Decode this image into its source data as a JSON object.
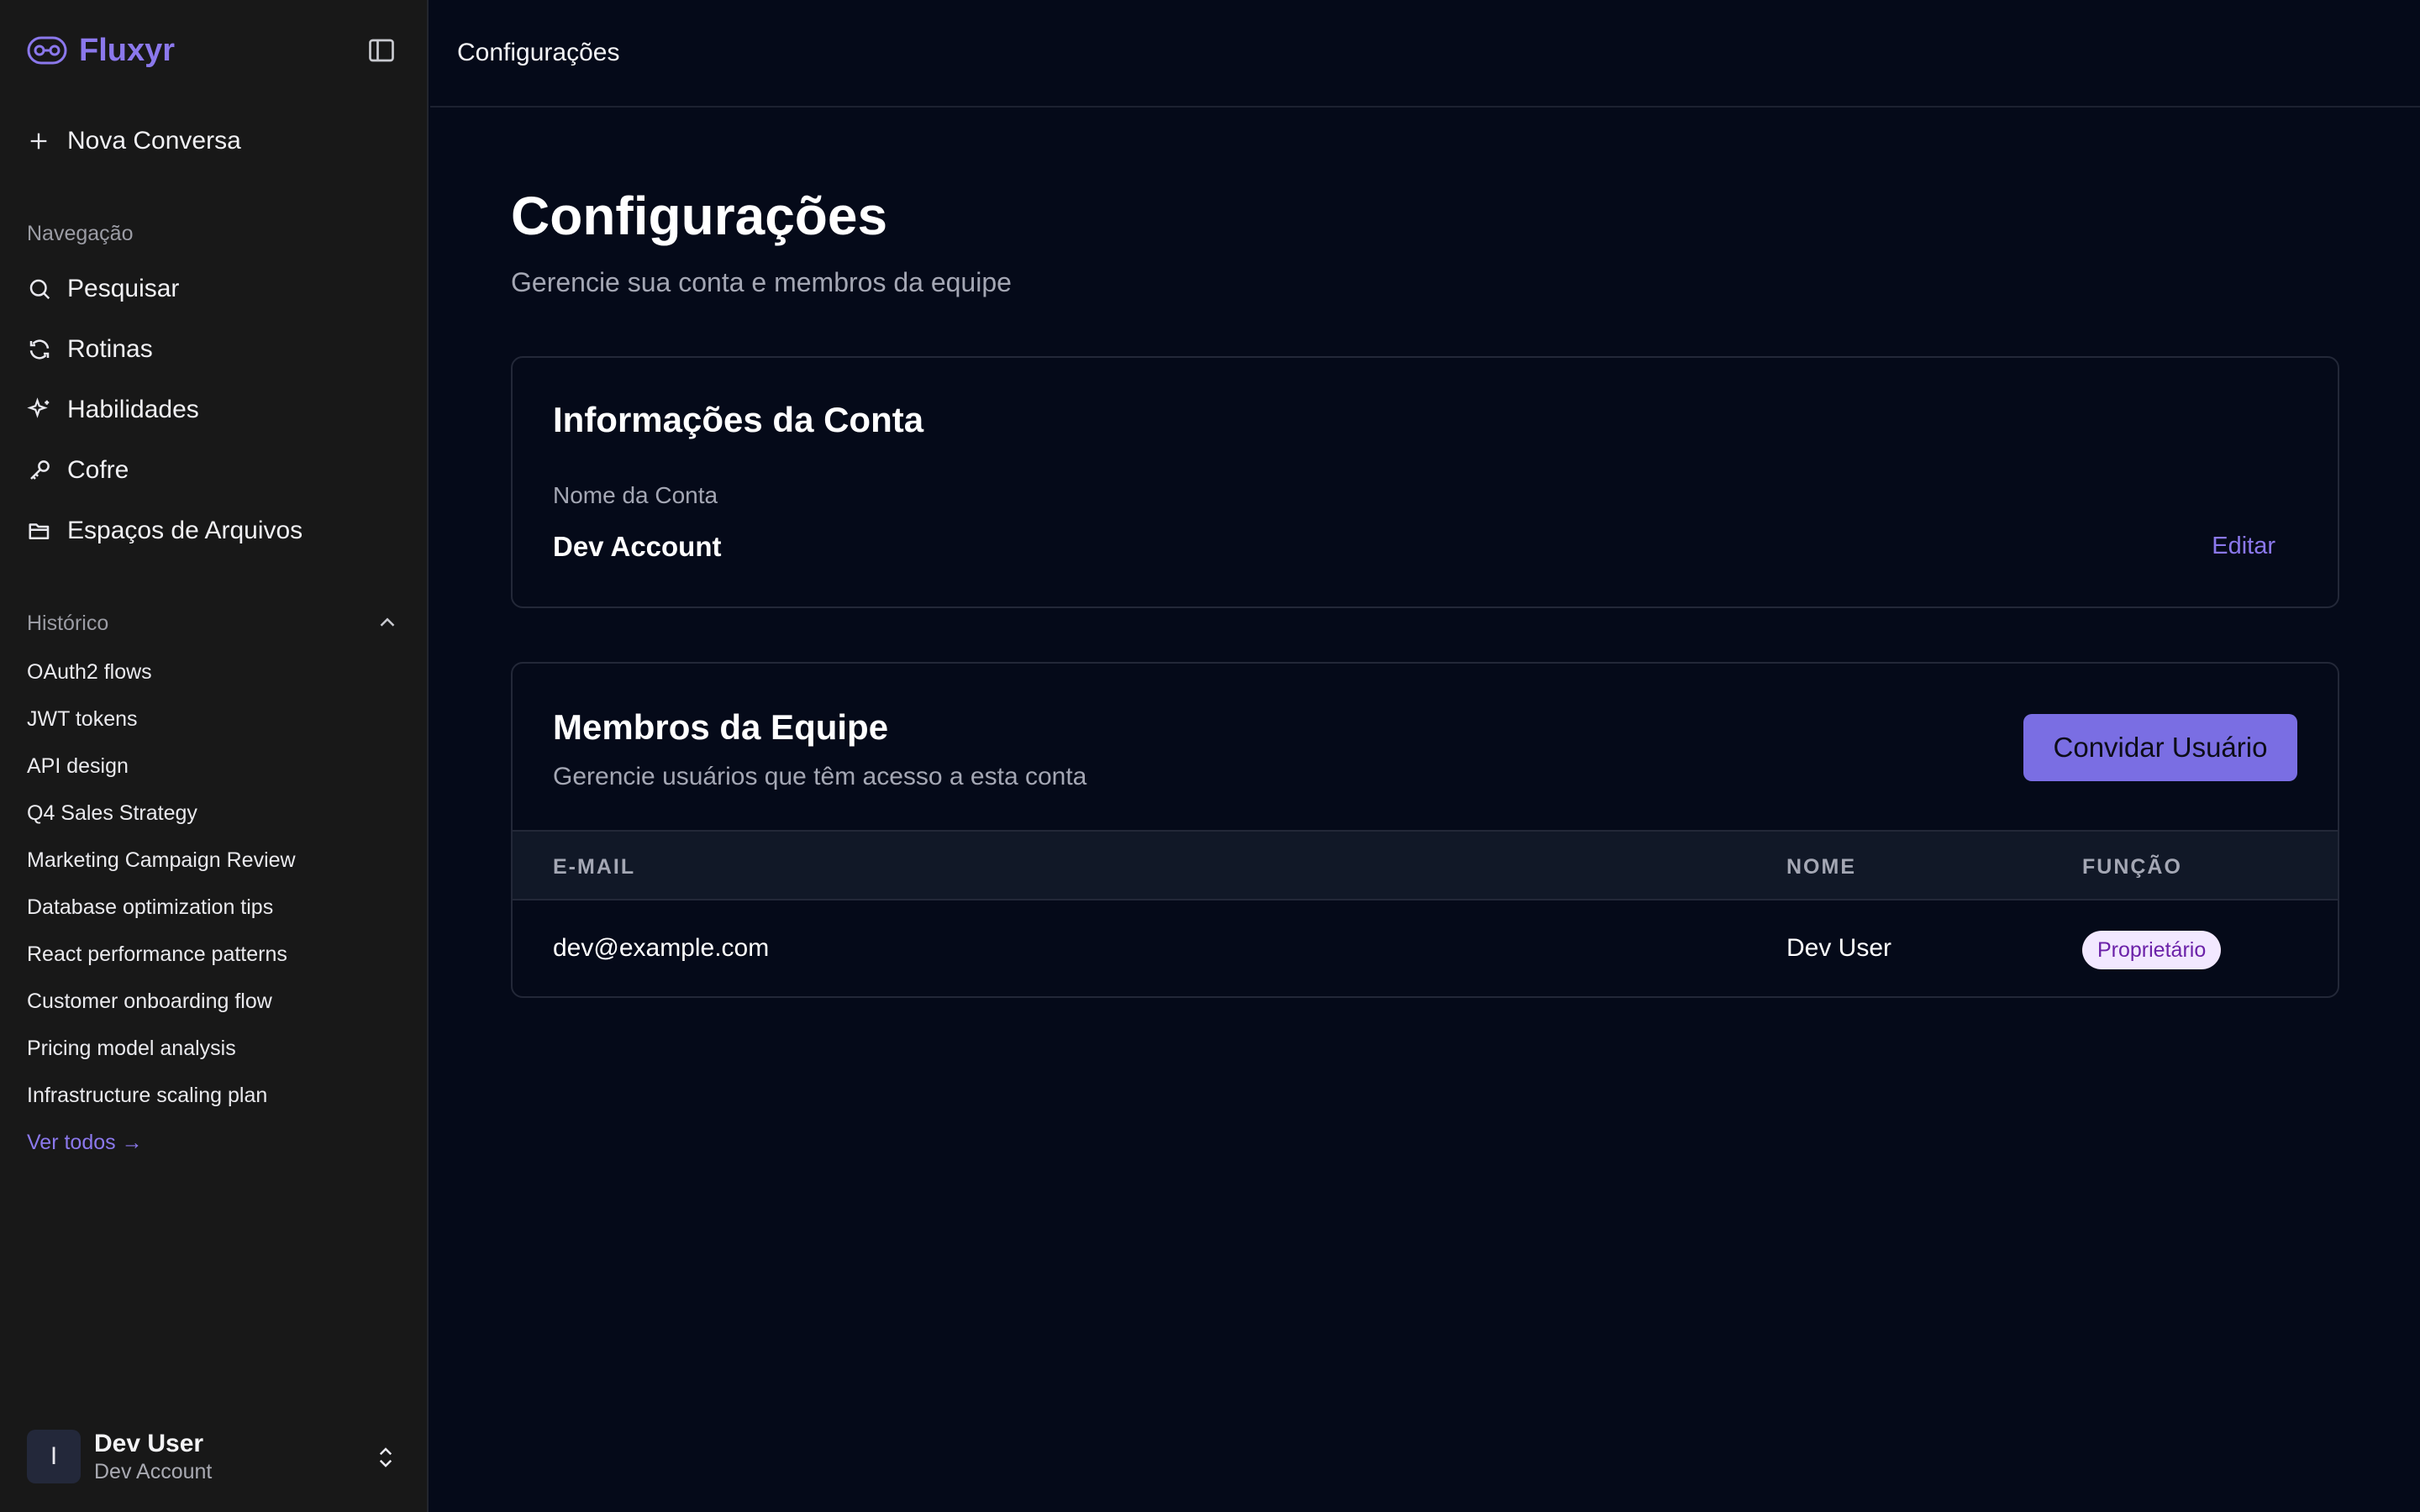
{
  "sidebar": {
    "brand": "Fluxyr",
    "new_chat": "Nova Conversa",
    "nav_label": "Navegação",
    "nav_items": [
      {
        "label": "Pesquisar",
        "icon": "search-icon"
      },
      {
        "label": "Rotinas",
        "icon": "refresh-icon"
      },
      {
        "label": "Habilidades",
        "icon": "sparkle-icon"
      },
      {
        "label": "Cofre",
        "icon": "key-icon"
      },
      {
        "label": "Espaços de Arquivos",
        "icon": "folder-icon"
      }
    ],
    "history_label": "Histórico",
    "history_items": [
      "OAuth2 flows",
      "JWT tokens",
      "API design",
      "Q4 Sales Strategy",
      "Marketing Campaign Review",
      "Database optimization tips",
      "React performance patterns",
      "Customer onboarding flow",
      "Pricing model analysis",
      "Infrastructure scaling plan"
    ],
    "see_all": "Ver todos →",
    "user": {
      "initial": "I",
      "name": "Dev User",
      "account": "Dev Account"
    }
  },
  "topbar": {
    "title": "Configurações"
  },
  "main": {
    "title": "Configurações",
    "subtitle": "Gerencie sua conta e membros da equipe",
    "account_card": {
      "title": "Informações da Conta",
      "field_label": "Nome da Conta",
      "field_value": "Dev Account",
      "edit": "Editar"
    },
    "team_card": {
      "title": "Membros da Equipe",
      "subtitle": "Gerencie usuários que têm acesso a esta conta",
      "invite": "Convidar Usuário",
      "columns": [
        "E-MAIL",
        "NOME",
        "FUNÇÃO"
      ],
      "rows": [
        {
          "email": "dev@example.com",
          "name": "Dev User",
          "role": "Proprietário"
        }
      ]
    }
  },
  "colors": {
    "accent": "#8b78ec",
    "button": "#7a6ee3",
    "sidebar_bg": "#181818",
    "main_bg": "#050a19",
    "badge_bg": "#f2e8ff",
    "badge_text": "#6b21a8"
  }
}
